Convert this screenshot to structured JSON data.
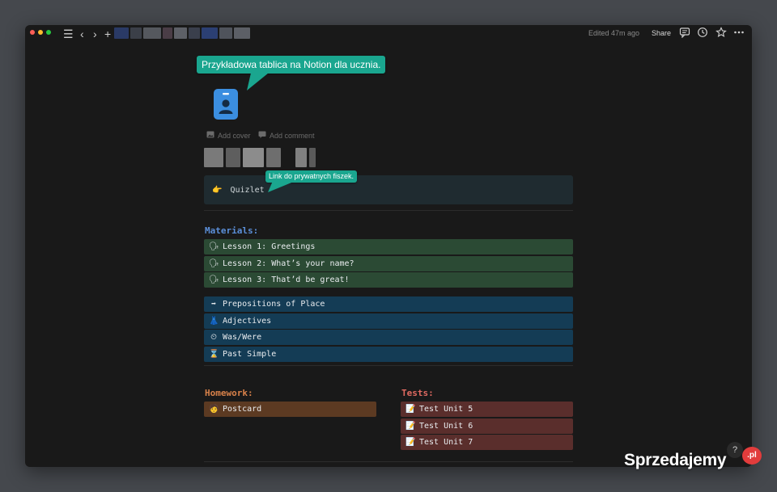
{
  "titlebar": {
    "edited": "Edited 47m ago",
    "share": "Share"
  },
  "tooltips": {
    "top": "Przykładowa tablica na Notion dla ucznia.",
    "callout": "Link do prywatnych fiszek."
  },
  "page_meta": {
    "add_cover": "Add cover",
    "add_comment": "Add comment"
  },
  "callout": {
    "emoji": "👉",
    "text": "Quizlet"
  },
  "materials": {
    "heading": "Materials:",
    "lessons": [
      {
        "emoji": "🗣",
        "label": "Lesson 1: Greetings"
      },
      {
        "emoji": "🗣",
        "label": "Lesson 2: What’s your name?"
      },
      {
        "emoji": "🗣",
        "label": "Lesson 3: That’d be great!"
      }
    ],
    "topics": [
      {
        "emoji": "➡",
        "label": "Prepositions of Place"
      },
      {
        "emoji": "👗",
        "label": "Adjectives"
      },
      {
        "emoji": "⏲",
        "label": "Was/Were"
      },
      {
        "emoji": "⌛",
        "label": "Past Simple"
      }
    ]
  },
  "homework": {
    "heading": "Homework:",
    "items": [
      {
        "emoji": "🧑",
        "label": "Postcard"
      }
    ]
  },
  "tests": {
    "heading": "Tests:",
    "items": [
      {
        "emoji": "📝",
        "label": "Test Unit 5"
      },
      {
        "emoji": "📝",
        "label": "Test Unit 6"
      },
      {
        "emoji": "📝",
        "label": "Test Unit 7"
      }
    ]
  },
  "help": "?",
  "watermark": {
    "brand": "Sprzedajemy",
    "badge": ".pl"
  },
  "colors": {
    "materials_heading": "#5b8fd9",
    "lesson_bg": "#2b4a34",
    "topic_bg": "#143c55",
    "homework_heading": "#d9824a",
    "homework_bg": "#5c3a22",
    "tests_heading": "#e06a61",
    "tests_bg": "#5a2e2c",
    "tooltip": "#1aa68f"
  }
}
